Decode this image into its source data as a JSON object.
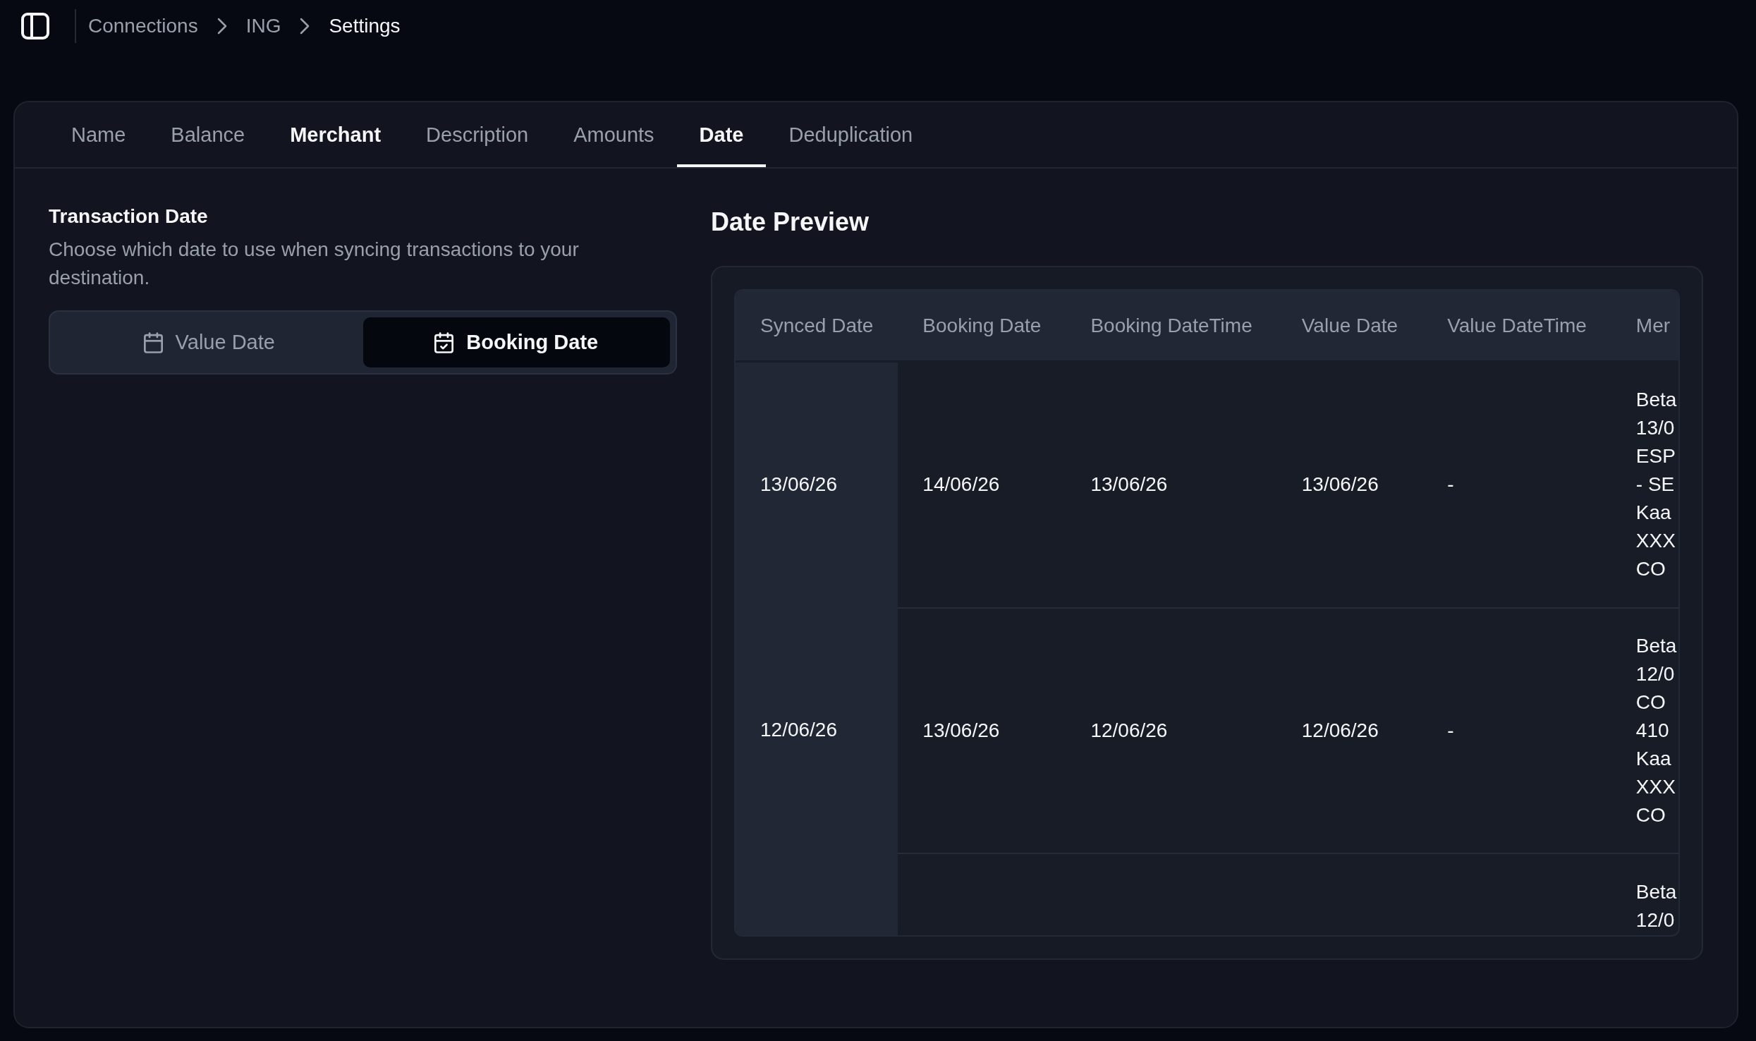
{
  "topbar": {
    "breadcrumbs": [
      {
        "label": "Connections",
        "current": false
      },
      {
        "label": "ING",
        "current": false
      },
      {
        "label": "Settings",
        "current": true
      }
    ]
  },
  "tabs": [
    {
      "label": "Name",
      "selected": false,
      "highlighted": false
    },
    {
      "label": "Balance",
      "selected": false,
      "highlighted": false
    },
    {
      "label": "Merchant",
      "selected": false,
      "highlighted": true
    },
    {
      "label": "Description",
      "selected": false,
      "highlighted": false
    },
    {
      "label": "Amounts",
      "selected": false,
      "highlighted": false
    },
    {
      "label": "Date",
      "selected": true,
      "highlighted": false
    },
    {
      "label": "Deduplication",
      "selected": false,
      "highlighted": false
    }
  ],
  "transaction_date": {
    "title": "Transaction Date",
    "description": "Choose which date to use when syncing transactions to your destination.",
    "options": [
      {
        "label": "Value Date",
        "selected": false
      },
      {
        "label": "Booking Date",
        "selected": true
      }
    ]
  },
  "date_preview": {
    "title": "Date Preview",
    "columns": {
      "synced_date": "Synced Date",
      "booking_date": "Booking Date",
      "booking_datetime": "Booking DateTime",
      "value_date": "Value Date",
      "value_datetime": "Value DateTime",
      "column_6": "Mer"
    },
    "rows": [
      {
        "synced_date": "13/06/26",
        "booking_date": "14/06/26",
        "booking_datetime": "13/06/26",
        "value_date": "13/06/26",
        "value_datetime": "-",
        "column_6": "Beta\n13/0\nESP\n- SE\nKaa\nXXX\nCO"
      },
      {
        "synced_date": "12/06/26",
        "booking_date": "13/06/26",
        "booking_datetime": "12/06/26",
        "value_date": "12/06/26",
        "value_datetime": "-",
        "column_6": "Beta\n12/0\nCO\n410\nKaa\nXXX\nCO"
      },
      {
        "column_6": "Beta\n12/0"
      }
    ]
  }
}
